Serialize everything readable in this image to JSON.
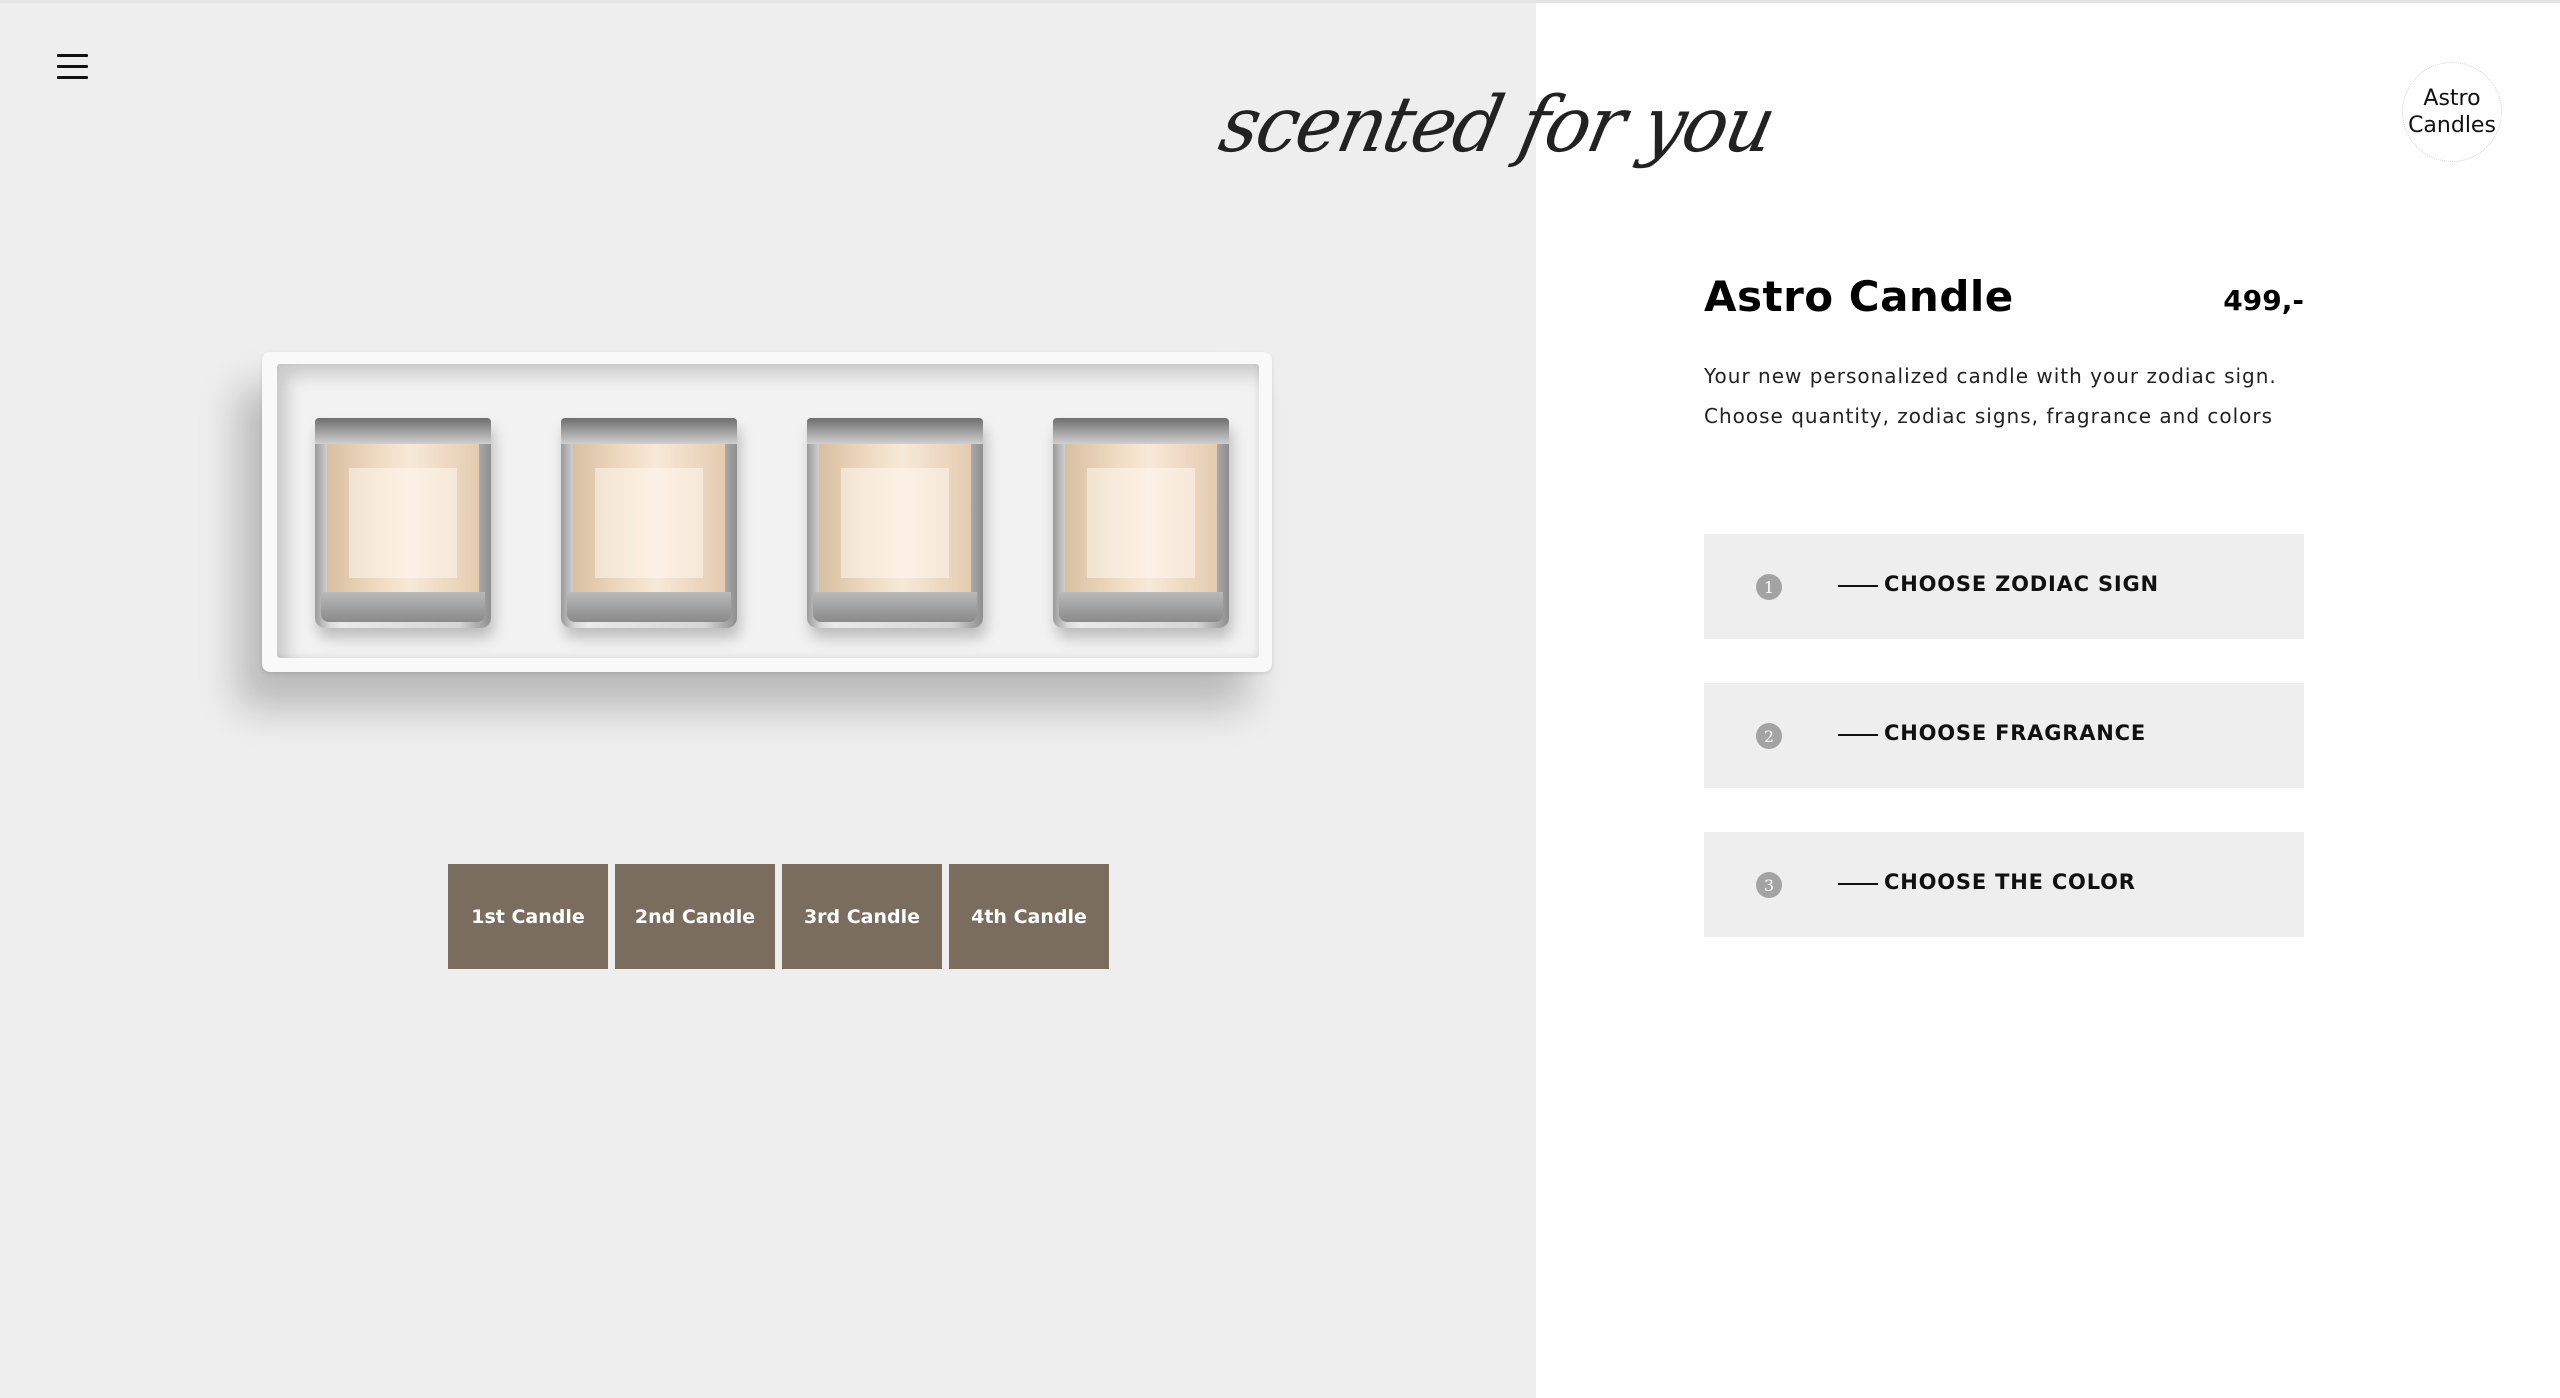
{
  "page": {
    "tagline": "scented for you",
    "menu_icon": "hamburger-menu-icon"
  },
  "logo": {
    "line1": "Astro",
    "line2": "Candles"
  },
  "product": {
    "title": "Astro Candle",
    "price": "499,-",
    "description_line1": "Your new personalized candle with your zodiac sign.",
    "description_line2": "Choose quantity, zodiac signs, fragrance and colors"
  },
  "candle_tabs": [
    {
      "label": "1st Candle"
    },
    {
      "label": "2nd Candle"
    },
    {
      "label": "3rd Candle"
    },
    {
      "label": "4th Candle"
    }
  ],
  "steps": [
    {
      "number": "1",
      "label": "CHOOSE ZODIAC SIGN"
    },
    {
      "number": "2",
      "label": "CHOOSE FRAGRANCE"
    },
    {
      "number": "3",
      "label": "CHOOSE THE COLOR"
    }
  ],
  "colors": {
    "left_background": "#eeeeee",
    "right_background": "#ffffff",
    "tab_color": "#7b6d5e",
    "step_background": "#eeeeee",
    "step_number_color": "#a3a3a3"
  }
}
